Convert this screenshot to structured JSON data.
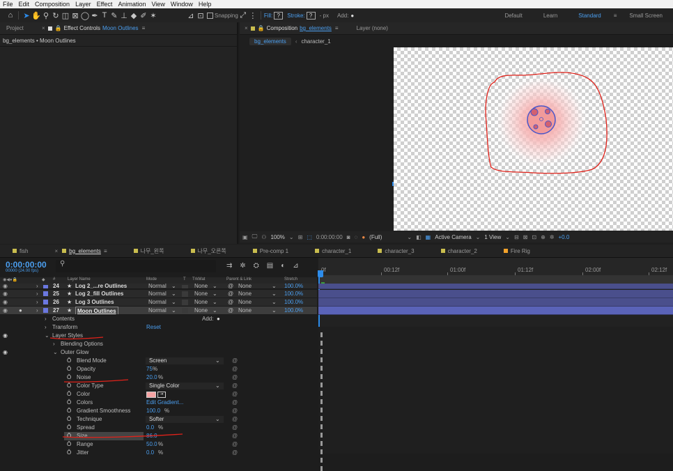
{
  "menu": [
    "File",
    "Edit",
    "Composition",
    "Layer",
    "Effect",
    "Animation",
    "View",
    "Window",
    "Help"
  ],
  "toolbar": {
    "snapping": "Snapping",
    "fill": "Fill:",
    "fill_value": "?",
    "stroke": "Stroke:",
    "stroke_value": "?",
    "stroke_px": "- px",
    "add": "Add:"
  },
  "workspaces": {
    "default": "Default",
    "learn": "Learn",
    "standard": "Standard",
    "small": "Small Screen"
  },
  "left_panel": {
    "tab_project": "Project",
    "tab_effect_controls": "Effect Controls",
    "effect_target": "Moon Outlines",
    "breadcrumb": "bg_elements • Moon Outlines"
  },
  "comp_panel": {
    "tab_label": "Composition",
    "comp_name": "bg_elements",
    "layer_tab": "Layer (none)",
    "flow_active": "bg_elements",
    "flow_next": "character_1"
  },
  "viewer_bar": {
    "zoom": "100%",
    "timecode": "0:00:00:00",
    "resolution": "(Full)",
    "camera": "Active Camera",
    "views": "1 View",
    "exposure": "+0.0"
  },
  "timeline_tabs": [
    {
      "label": "fish",
      "color": "#c9bd4e"
    },
    {
      "label": "bg_elements",
      "color": "#c9bd4e",
      "active": true
    },
    {
      "label": "나무_왼쪽",
      "color": "#c9bd4e"
    },
    {
      "label": "나무_오른쪽",
      "color": "#c9bd4e"
    },
    {
      "label": "Pre-comp 1",
      "color": "#c9bd4e"
    },
    {
      "label": "character_1",
      "color": "#c9bd4e"
    },
    {
      "label": "character_3",
      "color": "#c9bd4e"
    },
    {
      "label": "character_2",
      "color": "#c9bd4e"
    },
    {
      "label": "Fire Rig",
      "color": "#f3a22b"
    }
  ],
  "timeline": {
    "timecode": "0:00:00:00",
    "fps": "00000 (24.00 fps)"
  },
  "columns": {
    "num": "#",
    "layer_name": "Layer Name",
    "mode": "Mode",
    "t": "T",
    "trkmat": "TrkMat",
    "parent": "Parent & Link",
    "stretch": "Stretch"
  },
  "layers": [
    {
      "num": "24",
      "name": "Log 2_...re Outlines",
      "mode": "Normal",
      "trkmat": "None",
      "parent": "None",
      "stretch": "100.0%"
    },
    {
      "num": "25",
      "name": "Log 2_fill Outlines",
      "mode": "Normal",
      "trkmat": "None",
      "parent": "None",
      "stretch": "100.0%"
    },
    {
      "num": "26",
      "name": "Log 3 Outlines",
      "mode": "Normal",
      "trkmat": "None",
      "parent": "None",
      "stretch": "100.0%"
    },
    {
      "num": "27",
      "name": "Moon Outlines",
      "mode": "Normal",
      "trkmat": "None",
      "parent": "None",
      "stretch": "100.0%"
    }
  ],
  "props": {
    "contents": "Contents",
    "add": "Add:",
    "transform": "Transform",
    "reset": "Reset",
    "layer_styles": "Layer Styles",
    "blending": "Blending Options",
    "outer_glow": "Outer Glow",
    "blend_mode": "Blend Mode",
    "blend_mode_val": "Screen",
    "opacity": "Opacity",
    "opacity_val": "75",
    "pct": "%",
    "noise": "Noise",
    "noise_val": "20.0",
    "color_type": "Color Type",
    "color_type_val": "Single Color",
    "color": "Color",
    "colors": "Colors",
    "colors_val": "Edit Gradient...",
    "grad_smooth": "Gradient Smoothness",
    "grad_smooth_val": "100.0",
    "technique": "Technique",
    "technique_val": "Softer",
    "spread": "Spread",
    "spread_val": "0.0",
    "size": "Size",
    "size_val": "86.0",
    "range": "Range",
    "range_val": "50.0",
    "jitter": "Jitter",
    "jitter_val": "0.0"
  },
  "ruler": [
    "0f",
    "00:12f",
    "01:00f",
    "01:12f",
    "02:00f",
    "02:12f"
  ],
  "colors": {
    "accent": "#4b9ff0",
    "layer_bar": "#4a4f8c",
    "glow": "#f5a3a3",
    "moon": "#e89a9a",
    "annotation": "#e0221a"
  }
}
